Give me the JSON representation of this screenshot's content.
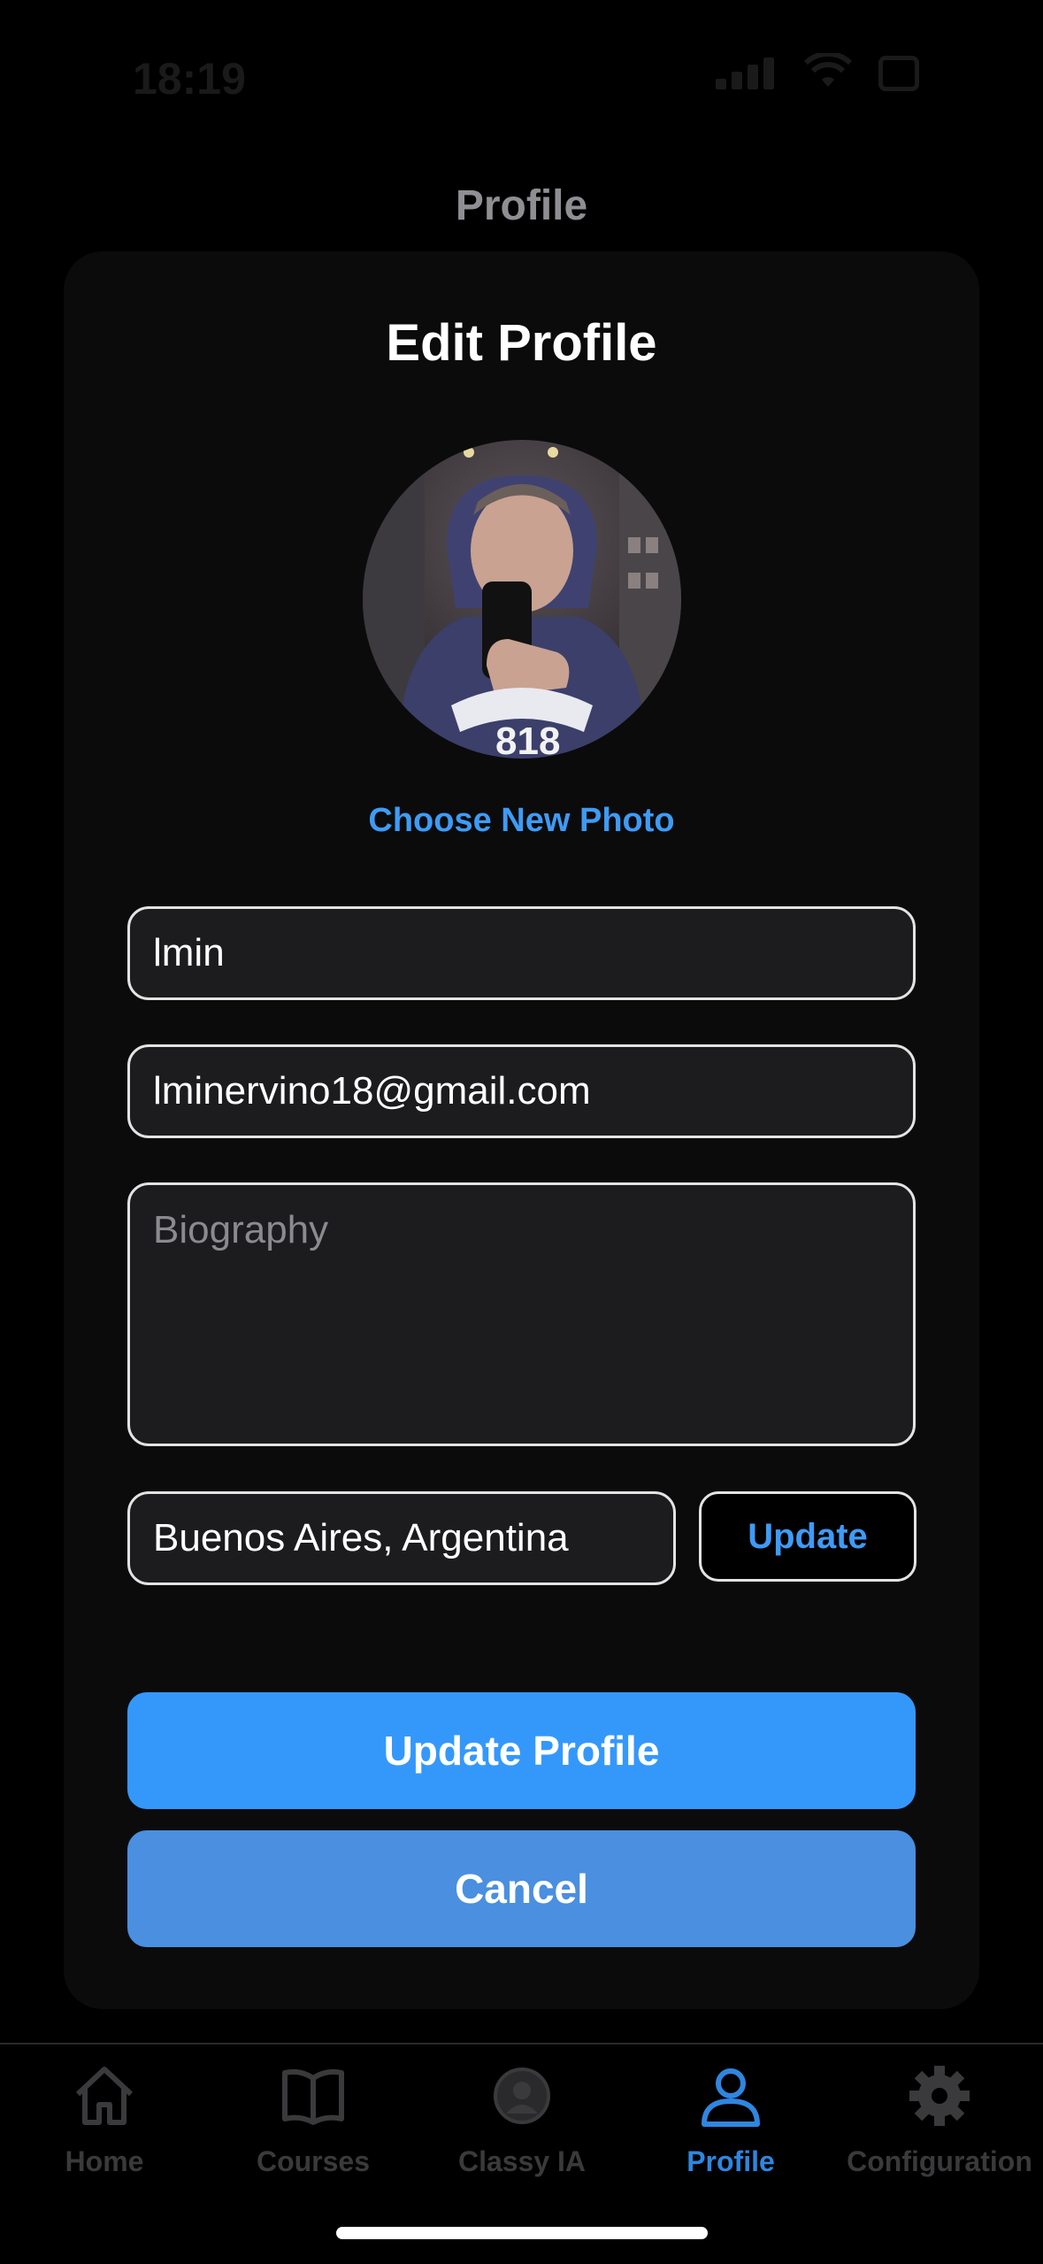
{
  "status_bar": {
    "time": "18:19"
  },
  "header": {
    "title": "Profile"
  },
  "card": {
    "title": "Edit Profile",
    "choose_photo_label": "Choose New Photo",
    "fields": {
      "name_value": "lmin",
      "email_value": "lminervino18@gmail.com",
      "biography_placeholder": "Biography",
      "location_value": "Buenos Aires, Argentina"
    },
    "update_location_label": "Update",
    "update_profile_label": "Update Profile",
    "cancel_label": "Cancel"
  },
  "tab_bar": {
    "items": [
      {
        "label": "Home",
        "icon": "house-icon",
        "active": false
      },
      {
        "label": "Courses",
        "icon": "book-icon",
        "active": false
      },
      {
        "label": "Classy IA",
        "icon": "robot-avatar-icon",
        "active": false
      },
      {
        "label": "Profile",
        "icon": "person-icon",
        "active": true
      },
      {
        "label": "Configuration",
        "icon": "gear-icon",
        "active": false
      }
    ]
  },
  "colors": {
    "accent": "#3498fb",
    "cancel": "#4a8fe0",
    "link": "#3e9bf5",
    "active_tab": "#2f86e0",
    "inactive_tab": "#3a3a3c"
  }
}
